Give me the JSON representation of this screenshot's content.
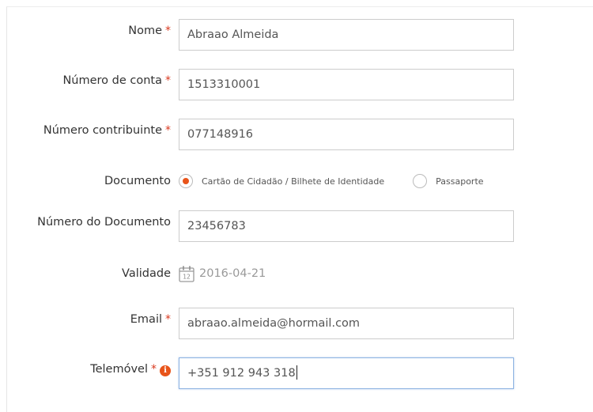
{
  "form": {
    "nome": {
      "label": "Nome",
      "required": "*",
      "value": "Abraao Almeida"
    },
    "conta": {
      "label": "Número de conta",
      "required": "*",
      "value": "1513310001"
    },
    "contribuinte": {
      "label": "Número contribuinte",
      "required": "*",
      "value": "077148916"
    },
    "documento": {
      "label": "Documento",
      "options": [
        {
          "label": "Cartão de Cidadão / Bilhete de Identidade",
          "selected": true
        },
        {
          "label": "Passaporte",
          "selected": false
        }
      ]
    },
    "numero_documento": {
      "label": "Número do Documento",
      "value": "23456783"
    },
    "validade": {
      "label": "Validade",
      "value": "2016-04-21",
      "calendar_day": "12",
      "icon": "calendar-icon"
    },
    "email": {
      "label": "Email",
      "required": "*",
      "value": "abraao.almeida@hormail.com"
    },
    "telemovel": {
      "label": "Telemóvel",
      "required": "*",
      "info_glyph": "i",
      "value": "+351 912 943 318",
      "icon": "info-icon"
    }
  },
  "colors": {
    "accent": "#e8541a",
    "required": "#d9381e",
    "focus_border": "#8db3e2",
    "input_border": "#cccccc"
  }
}
